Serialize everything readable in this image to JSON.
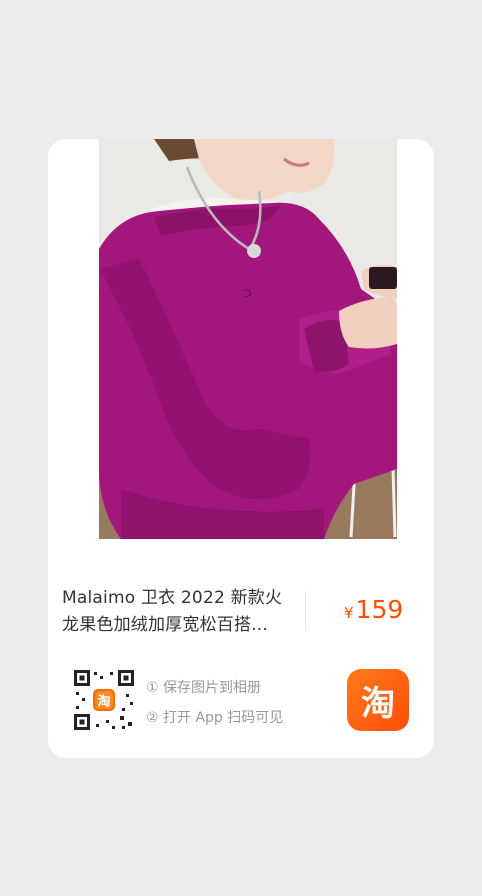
{
  "product": {
    "title_line1": "Malaimo 卫衣 2022 新款火",
    "title_line2": "龙果色加绒加厚宽松百搭...",
    "price_symbol": "¥",
    "price_value": "159"
  },
  "share": {
    "qr_badge_text": "淘",
    "step1": "① 保存图片到相册",
    "step2": "② 打开 App 扫码可见"
  },
  "brand": {
    "logo_text": "淘",
    "color": "#ff5000"
  },
  "colors": {
    "sweater": "#a3177d",
    "background": "#ececec",
    "card": "#ffffff"
  }
}
